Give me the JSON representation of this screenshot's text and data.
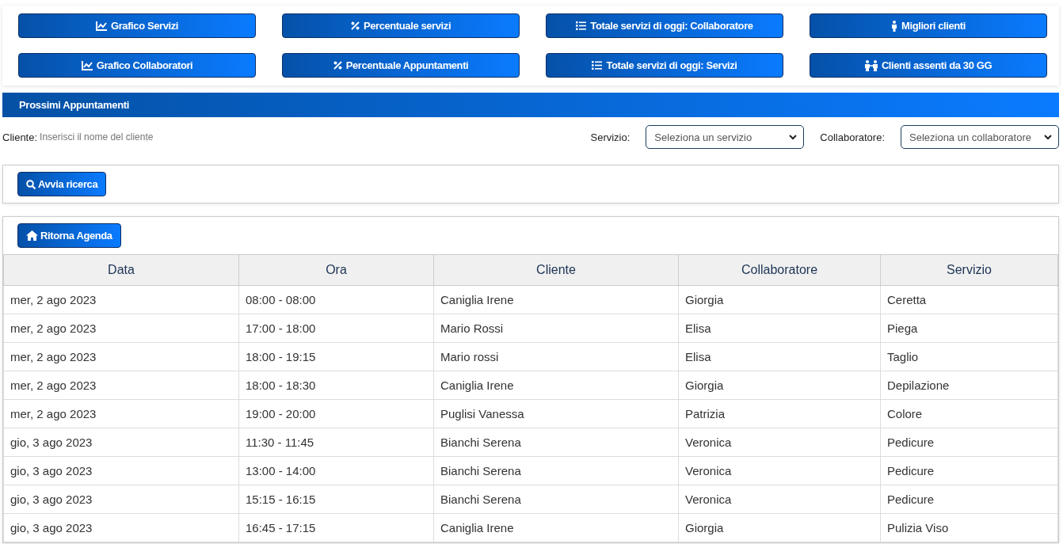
{
  "report_buttons": [
    {
      "label": "Grafico Servizi",
      "kind": "chart"
    },
    {
      "label": "Percentuale servizi",
      "kind": "percent"
    },
    {
      "label": "Totale servizi di oggi: Collaboratore",
      "kind": "list"
    },
    {
      "label": "Migliori clienti",
      "kind": "person"
    },
    {
      "label": "Grafico Collaboratori",
      "kind": "chart"
    },
    {
      "label": "Percentuale Appuntamenti",
      "kind": "percent"
    },
    {
      "label": "Totale servizi di oggi: Servizi",
      "kind": "list"
    },
    {
      "label": "Clienti assenti da 30 GG",
      "kind": "people"
    }
  ],
  "section_title": "Prossimi Appuntamenti",
  "filters": {
    "client": {
      "label": "Cliente:",
      "placeholder": "Inserisci il nome del cliente"
    },
    "service": {
      "label": "Servizio:",
      "value": "Seleziona un servizio"
    },
    "collaborator": {
      "label": "Collaboratore:",
      "value": "Seleziona un collaboratore"
    }
  },
  "search_button": "Avvia ricerca",
  "back_button": "Ritorna Agenda",
  "table": {
    "columns": [
      "Data",
      "Ora",
      "Cliente",
      "Collaboratore",
      "Servizio"
    ],
    "rows": [
      [
        "mer, 2 ago 2023",
        "08:00 - 08:00",
        "Caniglia Irene",
        "Giorgia",
        "Ceretta"
      ],
      [
        "mer, 2 ago 2023",
        "17:00 - 18:00",
        "Mario Rossi",
        "Elisa",
        "Piega"
      ],
      [
        "mer, 2 ago 2023",
        "18:00 - 19:15",
        "Mario rossi",
        "Elisa",
        "Taglio"
      ],
      [
        "mer, 2 ago 2023",
        "18:00 - 18:30",
        "Caniglia Irene",
        "Giorgia",
        "Depilazione"
      ],
      [
        "mer, 2 ago 2023",
        "19:00 - 20:00",
        "Puglisi Vanessa",
        "Patrizia",
        "Colore"
      ],
      [
        "gio, 3 ago 2023",
        "11:30 - 11:45",
        "Bianchi Serena",
        "Veronica",
        "Pedicure"
      ],
      [
        "gio, 3 ago 2023",
        "13:00 - 14:00",
        "Bianchi Serena",
        "Veronica",
        "Pedicure"
      ],
      [
        "gio, 3 ago 2023",
        "15:15 - 16:15",
        "Bianchi Serena",
        "Veronica",
        "Pedicure"
      ],
      [
        "gio, 3 ago 2023",
        "16:45 - 17:15",
        "Caniglia Irene",
        "Giorgia",
        "Pulizia Viso"
      ]
    ]
  }
}
